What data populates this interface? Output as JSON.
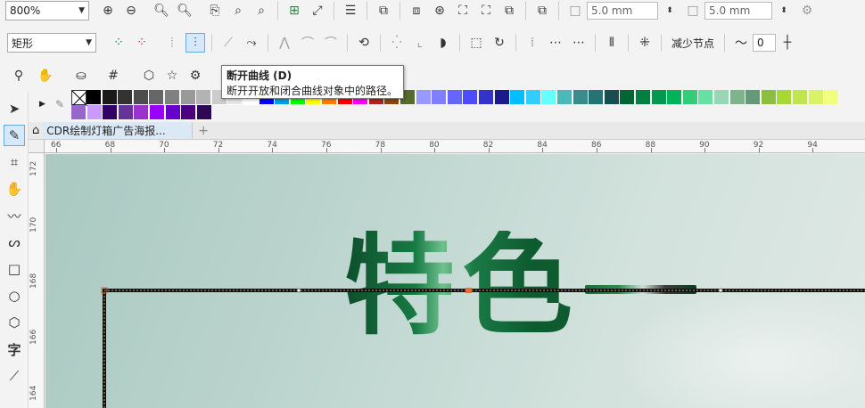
{
  "toolbar1": {
    "zoom_value": "800%",
    "width_field": "5.0 mm",
    "height_field": "5.0 mm"
  },
  "toolbar2": {
    "shape_select": "矩形",
    "reduce_nodes_label": "减少节点",
    "smooth_value": "0"
  },
  "tooltip": {
    "title": "断开曲线 (D)",
    "description": "断开开放和闭合曲线对象中的路径。"
  },
  "document_tab": {
    "title": "CDR绘制灯箱广告海报...",
    "add_tab": "+"
  },
  "ruler_h": {
    "ticks": [
      "66",
      "68",
      "70",
      "72",
      "74",
      "76",
      "78",
      "80",
      "82",
      "84",
      "86",
      "88",
      "90",
      "92",
      "94"
    ]
  },
  "ruler_v": {
    "ticks": [
      "172",
      "170",
      "168",
      "166",
      "164"
    ]
  },
  "canvas": {
    "headline": "特色"
  },
  "palette": {
    "row1": [
      "#000000",
      "#1a1a1a",
      "#333333",
      "#4d4d4d",
      "#666666",
      "#808080",
      "#999999",
      "#b3b3b3",
      "#cccccc",
      "#e6e6e6",
      "#ffffff",
      "#0000ff",
      "#00a0e9",
      "#00ff00",
      "#ffff00",
      "#ff7f00",
      "#ff0000",
      "#ff00ff",
      "#b22222",
      "#8b4513",
      "#556b2f",
      "#9999ff",
      "#7f7fff",
      "#6666ff",
      "#4d4dff",
      "#3333cc",
      "#1a1a8c",
      "#00bfff",
      "#33ccff",
      "#66ffff",
      "#4db8b8",
      "#3a8c8c",
      "#267373",
      "#1a4d4d",
      "#006633",
      "#008040",
      "#00994d",
      "#00b35a",
      "#33cc77",
      "#66e0a3",
      "#99d6b3",
      "#7fb38c",
      "#66997a",
      "#8cbf3f",
      "#a6d933",
      "#bfe64d",
      "#d9f266",
      "#f2ff80"
    ],
    "row2": [
      "#9966cc",
      "#cc99ff",
      "#330066",
      "#663399",
      "#9933cc",
      "#9900ff",
      "#6600cc",
      "#4b0082",
      "#2e0854"
    ]
  },
  "colors": {
    "accent_select": "#0078d7",
    "doc_tab_bg": "#dbe9f7",
    "path_line": "#2a1a10"
  }
}
